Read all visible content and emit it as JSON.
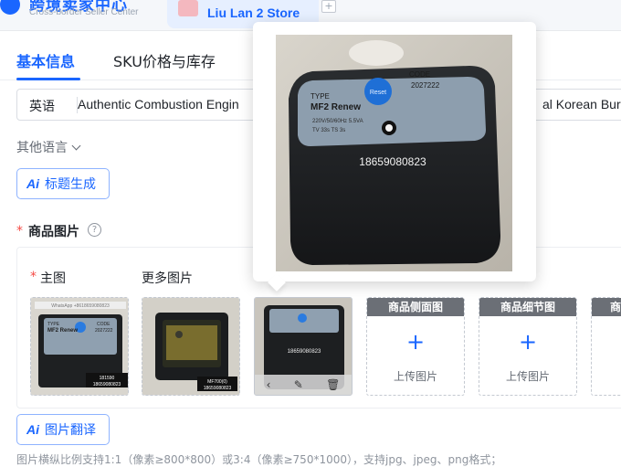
{
  "header": {
    "brand_title": "跨境卖家中心",
    "brand_subtitle": "Cross-border Seller Center",
    "store_name": "Liu Lan 2 Store",
    "add_tab_symbol": "+"
  },
  "tabs": [
    {
      "label": "基本信息",
      "active": true
    },
    {
      "label": "SKU价格与库存",
      "active": false
    }
  ],
  "title_field": {
    "language": "英语",
    "value": "Authentic Combustion Engin",
    "value_tail": "al Korean Burr"
  },
  "other_languages_label": "其他语言",
  "ai_title_button": {
    "icon": "Ai",
    "label": "标题生成"
  },
  "product_images": {
    "required_mark": "*",
    "label": "商品图片",
    "help_symbol": "?",
    "main_image_label": "主图",
    "more_images_label": "更多图片",
    "thumb_actions": [
      "‹",
      "✎",
      "🗑"
    ],
    "upload_slots": [
      {
        "header": "商品侧面图",
        "plus": "+",
        "text": "上传图片"
      },
      {
        "header": "商品细节图",
        "plus": "+",
        "text": "上传图片"
      },
      {
        "header": "商",
        "plus": "",
        "text": ""
      }
    ]
  },
  "ai_translate_button": {
    "icon": "Ai",
    "label": "图片翻译"
  },
  "footnote": "图片横纵比例支持1:1（像素≥800*800）或3:4（像素≥750*1000），支持jpg、jpeg、png格式；",
  "preview_photo": {
    "type_label": "TYPE",
    "model": "MF2 Renew",
    "code_label": "CODE",
    "code": "2027222",
    "reset_label": "Reset",
    "specs_line1": "220V/50/60Hz 5.5VA",
    "specs_line2": "TV 33s  TS 3s",
    "phone": "18659080823"
  },
  "thumb1_photo": {
    "whatsapp": "WhatsApp +8618659080823",
    "type": "TYPE",
    "model": "MF2 Renew",
    "code_label": "CODE",
    "code": "2027222",
    "tag_id": "181590",
    "tag_phone": "18659080823"
  },
  "thumb2_photo": {
    "tag_id": "MF700(0)",
    "tag_phone": "18659080823"
  },
  "thumb3_photo": {
    "phone": "18659080823"
  }
}
